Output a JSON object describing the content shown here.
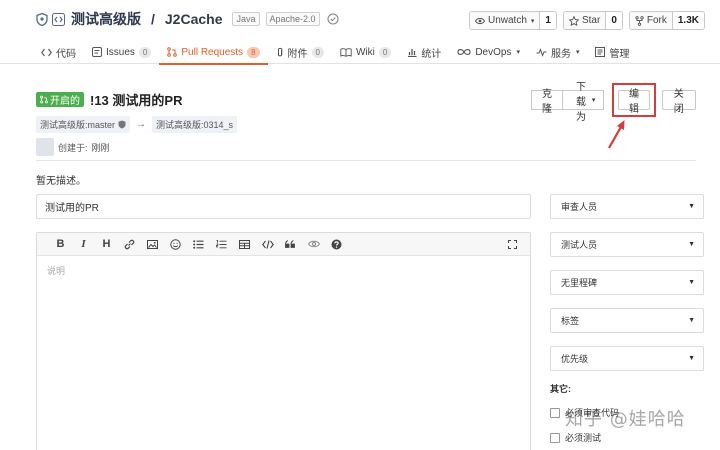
{
  "repo": {
    "owner": "测试高级版",
    "separator": "/",
    "name": "J2Cache",
    "tags": [
      "Java",
      "Apache-2.0"
    ]
  },
  "actions": [
    {
      "label": "Unwatch",
      "count": "1",
      "icon": "eye-icon",
      "caret": true
    },
    {
      "label": "Star",
      "count": "0",
      "icon": "star-icon",
      "caret": false
    },
    {
      "label": "Fork",
      "count": "1.3K",
      "icon": "fork-icon",
      "caret": false
    }
  ],
  "tabs": [
    {
      "label": "代码",
      "badge": ""
    },
    {
      "label": "Issues",
      "badge": "0"
    },
    {
      "label": "Pull Requests",
      "badge": "8"
    },
    {
      "label": "附件",
      "badge": "0"
    },
    {
      "label": "Wiki",
      "badge": "0"
    },
    {
      "label": "统计",
      "badge": ""
    },
    {
      "label": "DevOps",
      "badge": ""
    },
    {
      "label": "服务",
      "badge": ""
    },
    {
      "label": "管理",
      "badge": ""
    }
  ],
  "pr": {
    "status": "开启的",
    "title": "!13 测试用的PR",
    "source_branch": "测试高级版:master",
    "arrow": "→",
    "target_branch": "测试高级版:0314_s",
    "created_label": "创建于:",
    "created_time": "刚刚",
    "buttons": {
      "clone": "克隆",
      "download": "下载为",
      "edit": "编辑",
      "close": "关闭"
    }
  },
  "description": "暂无描述。",
  "form": {
    "title_value": "测试用的PR",
    "editor_placeholder": "说明",
    "toolbar_text": {
      "bold": "B",
      "italic": "I",
      "heading": "H"
    }
  },
  "sidebar": {
    "selects": [
      "审查人员",
      "测试人员",
      "无里程碑",
      "标签",
      "优先级"
    ],
    "other_label": "其它:",
    "checkboxes": [
      "必须审查代码",
      "必须测试"
    ]
  },
  "watermark": "知乎 @娃哈哈",
  "colors": {
    "accent": "#e35d2f",
    "open_status": "#4cae4c",
    "annotation": "#d93a3a"
  }
}
